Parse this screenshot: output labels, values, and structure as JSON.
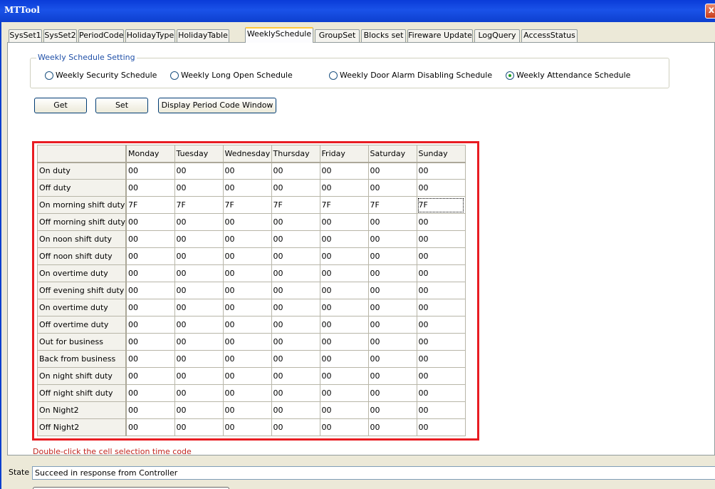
{
  "window": {
    "title": "MTTool",
    "close_label": "x"
  },
  "tabs": [
    {
      "label": "SysSet1"
    },
    {
      "label": "SysSet2"
    },
    {
      "label": "PeriodCode"
    },
    {
      "label": "HolidayType"
    },
    {
      "label": "HolidayTable"
    },
    {
      "label": "WeeklySchedule",
      "active": true
    },
    {
      "label": "GroupSet"
    },
    {
      "label": "Blocks set"
    },
    {
      "label": "Fireware Update"
    },
    {
      "label": "LogQuery"
    },
    {
      "label": "AccessStatus"
    }
  ],
  "schedule_group": {
    "legend": "Weekly Schedule Setting",
    "options": [
      {
        "label": "Weekly Security Schedule",
        "checked": false
      },
      {
        "label": "Weekly Long Open Schedule",
        "checked": false
      },
      {
        "label": "Weekly Door Alarm Disabling Schedule",
        "checked": false
      },
      {
        "label": "Weekly Attendance Schedule",
        "checked": true
      }
    ]
  },
  "buttons": {
    "get": "Get",
    "set": "Set",
    "display": "Display Period Code Window"
  },
  "grid": {
    "columns": [
      "Monday",
      "Tuesday",
      "Wednesday",
      "Thursday",
      "Friday",
      "Saturday",
      "Sunday"
    ],
    "rows": [
      {
        "label": "On duty",
        "values": [
          "00",
          "00",
          "00",
          "00",
          "00",
          "00",
          "00"
        ]
      },
      {
        "label": "Off duty",
        "values": [
          "00",
          "00",
          "00",
          "00",
          "00",
          "00",
          "00"
        ]
      },
      {
        "label": "On morning shift duty",
        "values": [
          "7F",
          "7F",
          "7F",
          "7F",
          "7F",
          "7F",
          "7F"
        ]
      },
      {
        "label": "Off morning shift duty",
        "values": [
          "00",
          "00",
          "00",
          "00",
          "00",
          "00",
          "00"
        ]
      },
      {
        "label": "On noon shift duty",
        "values": [
          "00",
          "00",
          "00",
          "00",
          "00",
          "00",
          "00"
        ]
      },
      {
        "label": "Off noon shift duty",
        "values": [
          "00",
          "00",
          "00",
          "00",
          "00",
          "00",
          "00"
        ]
      },
      {
        "label": "On overtime duty",
        "values": [
          "00",
          "00",
          "00",
          "00",
          "00",
          "00",
          "00"
        ]
      },
      {
        "label": "Off evening shift duty",
        "values": [
          "00",
          "00",
          "00",
          "00",
          "00",
          "00",
          "00"
        ]
      },
      {
        "label": "On overtime duty",
        "values": [
          "00",
          "00",
          "00",
          "00",
          "00",
          "00",
          "00"
        ]
      },
      {
        "label": "Off overtime duty",
        "values": [
          "00",
          "00",
          "00",
          "00",
          "00",
          "00",
          "00"
        ]
      },
      {
        "label": "Out for business",
        "values": [
          "00",
          "00",
          "00",
          "00",
          "00",
          "00",
          "00"
        ]
      },
      {
        "label": "Back from business",
        "values": [
          "00",
          "00",
          "00",
          "00",
          "00",
          "00",
          "00"
        ]
      },
      {
        "label": "On night shift duty",
        "values": [
          "00",
          "00",
          "00",
          "00",
          "00",
          "00",
          "00"
        ]
      },
      {
        "label": "Off night shift duty",
        "values": [
          "00",
          "00",
          "00",
          "00",
          "00",
          "00",
          "00"
        ]
      },
      {
        "label": "On Night2",
        "values": [
          "00",
          "00",
          "00",
          "00",
          "00",
          "00",
          "00"
        ]
      },
      {
        "label": "Off Night2",
        "values": [
          "00",
          "00",
          "00",
          "00",
          "00",
          "00",
          "00"
        ]
      }
    ]
  },
  "hint": "Double-click the cell selection time code",
  "status": {
    "label": "State",
    "value": "Succeed in response from Controller",
    "progress": 0
  },
  "colors": {
    "title_bar": "#0a3bd8",
    "highlight_frame": "#e81c22",
    "hint_text": "#c0241d",
    "active_tab_accent": "#ffc83c"
  }
}
